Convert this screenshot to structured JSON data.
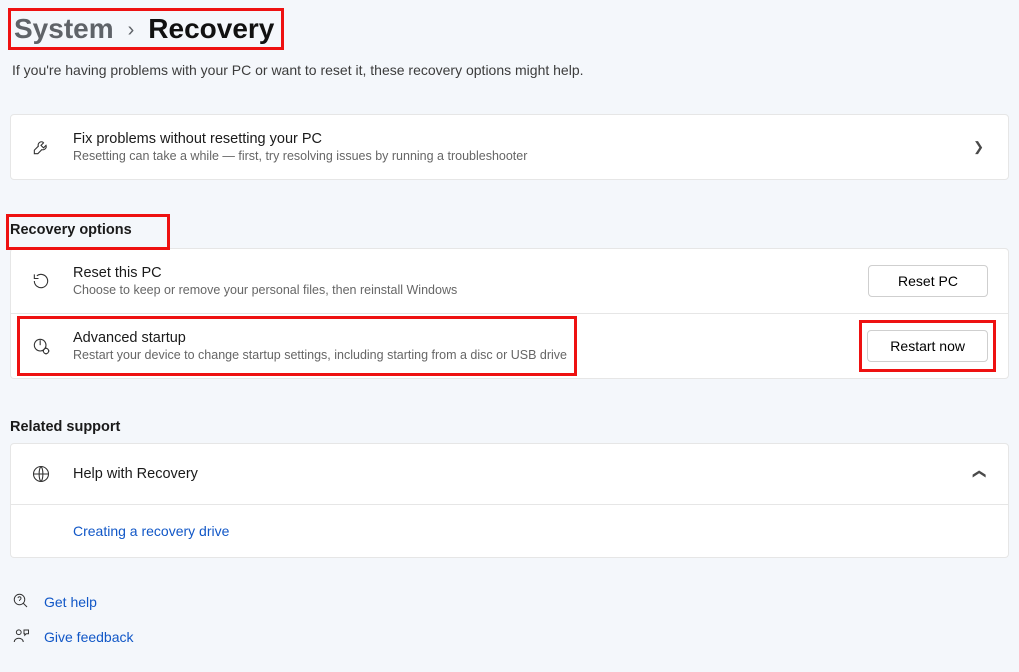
{
  "breadcrumb": {
    "parent": "System",
    "current": "Recovery"
  },
  "subtitle": "If you're having problems with your PC or want to reset it, these recovery options might help.",
  "fix": {
    "title": "Fix problems without resetting your PC",
    "desc": "Resetting can take a while — first, try resolving issues by running a troubleshooter"
  },
  "recovery": {
    "section_label": "Recovery options",
    "reset": {
      "title": "Reset this PC",
      "desc": "Choose to keep or remove your personal files, then reinstall Windows",
      "button": "Reset PC"
    },
    "advanced": {
      "title": "Advanced startup",
      "desc": "Restart your device to change startup settings, including starting from a disc or USB drive",
      "button": "Restart now"
    }
  },
  "related": {
    "section_label": "Related support",
    "help_title": "Help with Recovery",
    "link": "Creating a recovery drive"
  },
  "footer": {
    "get_help": "Get help",
    "give_feedback": "Give feedback"
  }
}
